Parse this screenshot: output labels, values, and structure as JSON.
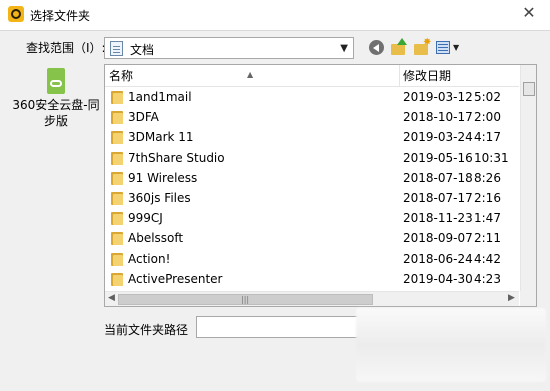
{
  "window": {
    "title": "选择文件夹",
    "close_glyph": "✕",
    "icon": "app-logo-icon"
  },
  "look_in": {
    "label": "查找范围（I）:",
    "value": "文档",
    "icon": "documents-icon"
  },
  "toolbar": {
    "back_icon": "back-icon",
    "up_icon": "up-folder-icon",
    "new_folder_icon": "new-folder-icon",
    "view_icon": "view-menu-icon"
  },
  "places": {
    "item_label": "360安全云盘-同步版",
    "item_icon": "cloud-drive-icon"
  },
  "file_list": {
    "columns": {
      "name": "名称",
      "date": "修改日期"
    },
    "rows": [
      {
        "name": "1and1mail",
        "date": "2019-03-12",
        "time": "5:02"
      },
      {
        "name": "3DFA",
        "date": "2018-10-17",
        "time": "2:00"
      },
      {
        "name": "3DMark 11",
        "date": "2019-03-24",
        "time": "4:17"
      },
      {
        "name": "7thShare Studio",
        "date": "2019-05-16",
        "time": "10:31"
      },
      {
        "name": "91 Wireless",
        "date": "2018-07-18",
        "time": "8:26"
      },
      {
        "name": "360js Files",
        "date": "2018-07-17",
        "time": "2:16"
      },
      {
        "name": "999CJ",
        "date": "2018-11-23",
        "time": "1:47"
      },
      {
        "name": "Abelssoft",
        "date": "2018-09-07",
        "time": "2:11"
      },
      {
        "name": "Action!",
        "date": "2018-06-24",
        "time": "4:42"
      },
      {
        "name": "ActivePresenter",
        "date": "2019-04-30",
        "time": "4:23"
      }
    ]
  },
  "path": {
    "label": "当前文件夹路径",
    "value": ""
  },
  "colors": {
    "window_bg": "#f0f0f0",
    "folder": "#f4d26f",
    "folder_dark": "#d9a832"
  }
}
